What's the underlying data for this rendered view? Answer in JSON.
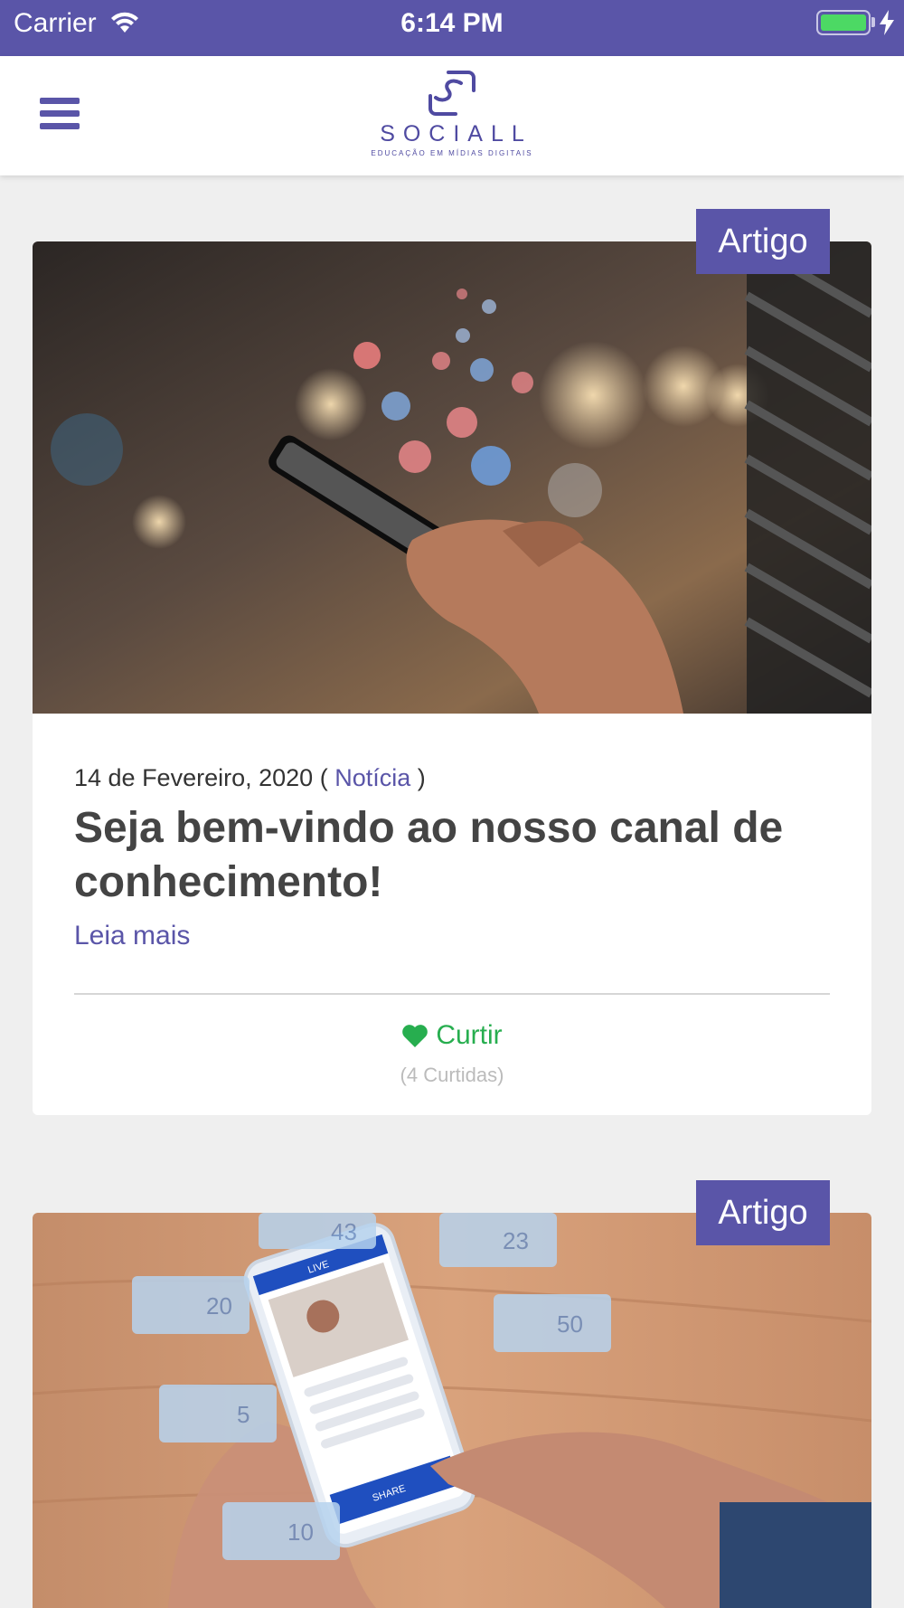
{
  "status_bar": {
    "carrier": "Carrier",
    "time": "6:14 PM",
    "battery_color": "#4cd964"
  },
  "header": {
    "menu_icon": "hamburger-menu-icon",
    "logo": {
      "brand": "SOCIALL",
      "tagline": "EDUCAÇÃO EM MÍDIAS DIGITAIS"
    },
    "accent_color": "#5a55a8"
  },
  "posts": [
    {
      "badge": "Artigo",
      "image": "hand-holding-smartphone-with-social-icons",
      "date": "14 de Fevereiro, 2020",
      "open_paren": "(",
      "category": "Notícia",
      "close_paren": ")",
      "title": "Seja bem-vindo ao nosso canal de conhecimento!",
      "read_more": "Leia mais",
      "like_label": "Curtir",
      "like_icon": "heart-icon",
      "likes_count": "(4 Curtidas)"
    },
    {
      "badge": "Artigo",
      "image": "phone-live-stream-with-social-stats",
      "overlay_stats": {
        "comments": "43",
        "messages": "23",
        "videos": "20",
        "followers": "50",
        "locations": "5",
        "shares": "10",
        "live_label": "LIVE",
        "share_label": "SHARE"
      }
    }
  ]
}
